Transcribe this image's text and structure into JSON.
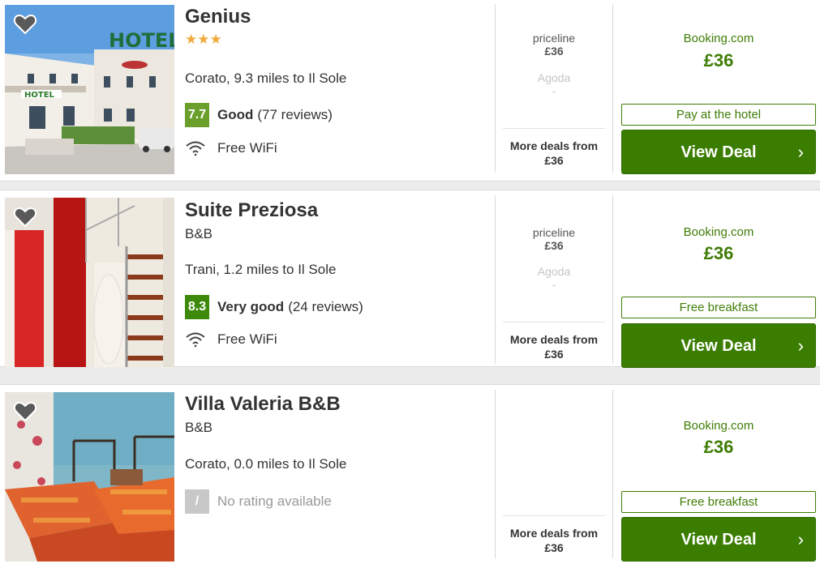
{
  "hotels": [
    {
      "name": "Genius",
      "stars": "★★★",
      "type": "",
      "location": "Corato, 9.3 miles to Il Sole",
      "score": "7.7",
      "score_color": "#6a9f2c",
      "rating_word": "Good",
      "reviews": "(77 reviews)",
      "amenity": "Free WiFi",
      "alt_provider_1": "priceline",
      "alt_price_1": "£36",
      "alt_provider_2": "Agoda",
      "alt_price_2": "-",
      "more_deals": "More deals from",
      "more_price": "£36",
      "deal_provider": "Booking.com",
      "deal_price": "£36",
      "perk": "Pay at the hotel",
      "button": "View Deal"
    },
    {
      "name": "Suite Preziosa",
      "stars": "",
      "type": "B&B",
      "location": "Trani, 1.2 miles to Il Sole",
      "score": "8.3",
      "score_color": "#3d8a0a",
      "rating_word": "Very good",
      "reviews": "(24 reviews)",
      "amenity": "Free WiFi",
      "alt_provider_1": "priceline",
      "alt_price_1": "£36",
      "alt_provider_2": "Agoda",
      "alt_price_2": "-",
      "more_deals": "More deals from",
      "more_price": "£36",
      "deal_provider": "Booking.com",
      "deal_price": "£36",
      "perk": "Free breakfast",
      "button": "View Deal"
    },
    {
      "name": "Villa Valeria B&B",
      "stars": "",
      "type": "B&B",
      "location": "Corato, 0.0 miles to Il Sole",
      "score": "/",
      "rating_word": "No rating available",
      "more_deals": "More deals from",
      "more_price": "£36",
      "deal_provider": "Booking.com",
      "deal_price": "£36",
      "perk": "Free breakfast",
      "button": "View Deal"
    }
  ],
  "colors": {
    "accent": "#3a7d00",
    "star": "#f1a93b"
  },
  "icons": {
    "favorite": "heart-icon",
    "wifi": "wifi-icon",
    "chevron": "chevron-right-icon"
  }
}
